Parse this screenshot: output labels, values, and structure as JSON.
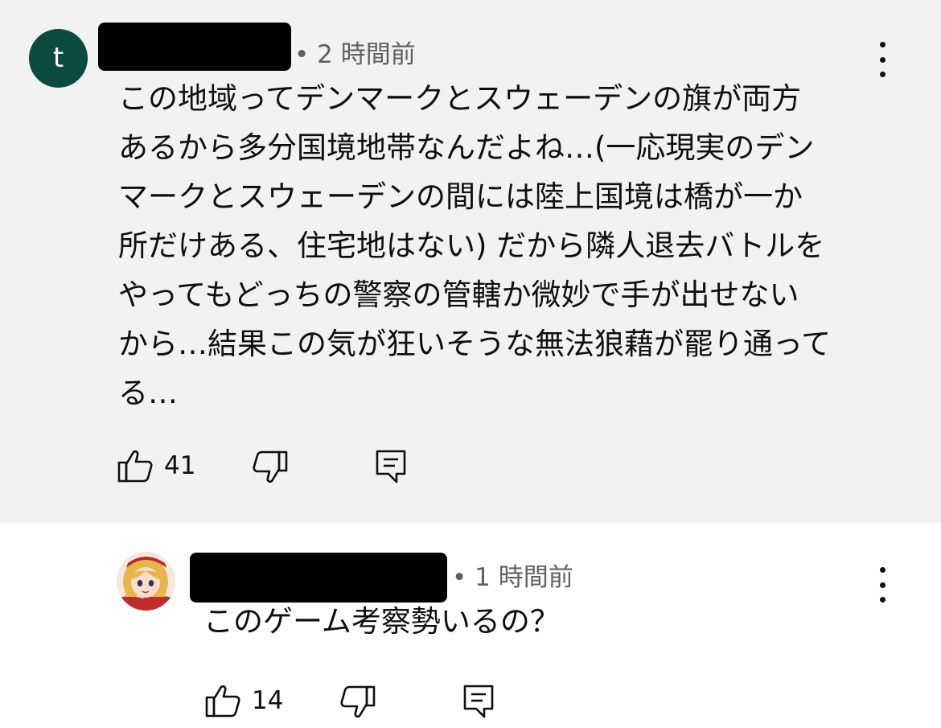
{
  "comments": [
    {
      "avatar_letter": "t",
      "avatar_color": "#0b4a3e",
      "time": "• 2 時間前",
      "text_lines": [
        "この地域ってデンマークとスウェーデンの旗が両方",
        "あるから多分国境地帯なんだよね…(一応現実のデン",
        "マークとスウェーデンの間には陸上国境は橋が一か",
        "所だけある、住宅地はない) だから隣人退去バトルを",
        "やってもどっちの警察の管轄か微妙で手が出せない",
        "から…結果この気が狂いそうな無法狼藉が罷り通って",
        "る…"
      ],
      "like_count": "41",
      "like_icon": "thumbs-up-icon",
      "dislike_icon": "thumbs-down-icon",
      "reply_icon": "comment-icon",
      "background": "#f2f2f2"
    },
    {
      "avatar": "anime-character-avatar",
      "time": "• 1 時間前",
      "text": "このゲーム考察勢いるの？",
      "like_count": "14",
      "like_icon": "thumbs-up-icon",
      "dislike_icon": "thumbs-down-icon",
      "reply_icon": "comment-icon",
      "background": "#ffffff"
    }
  ],
  "more_icon": "more-vertical-icon"
}
